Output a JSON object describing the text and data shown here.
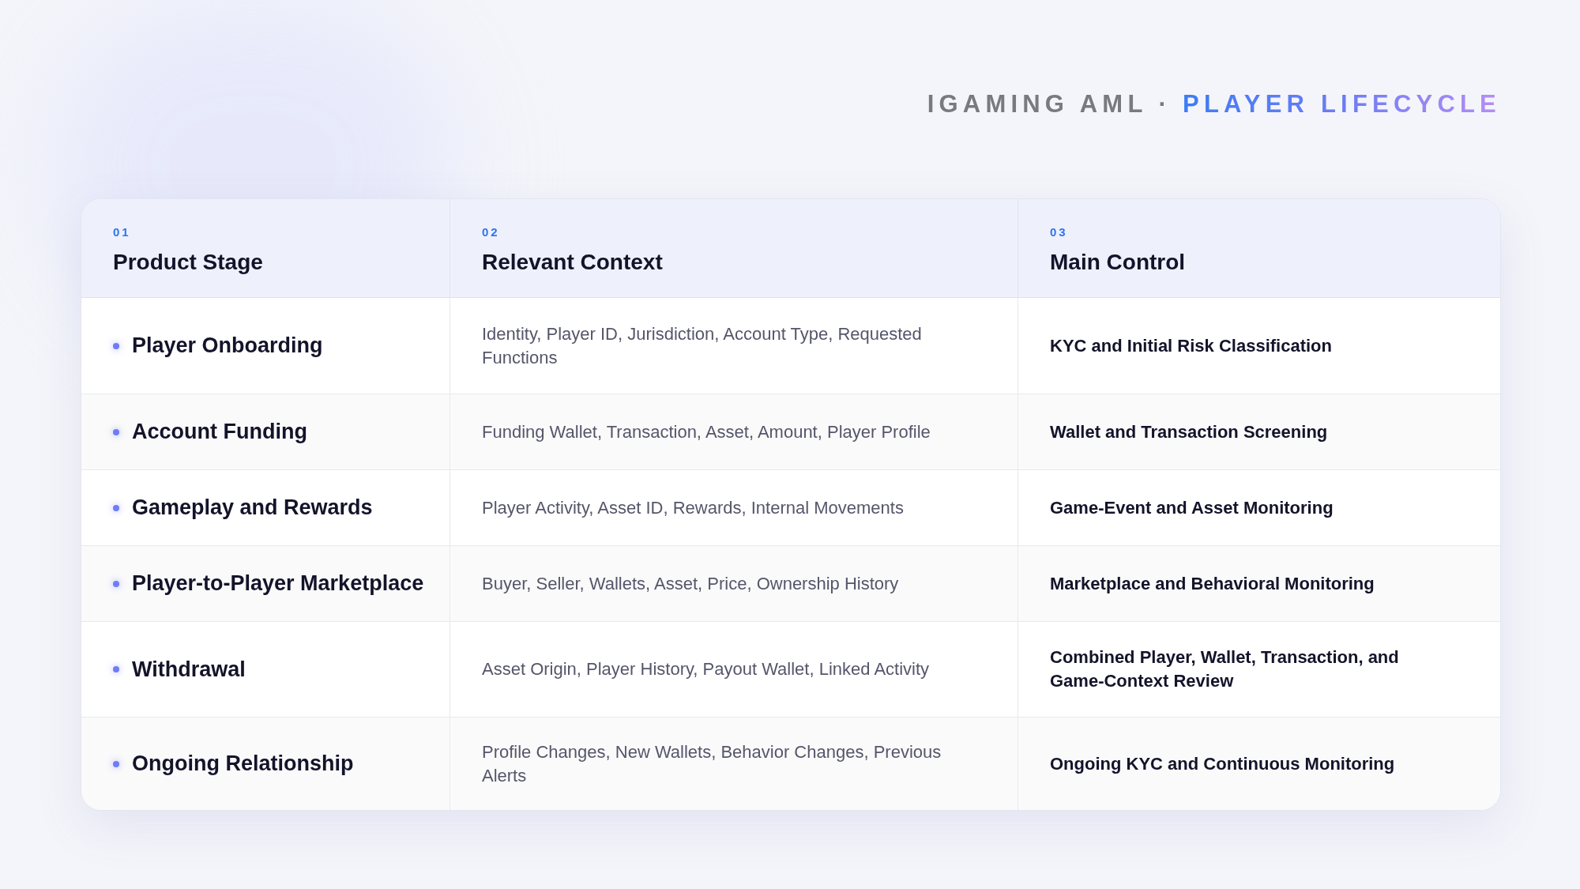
{
  "heading": {
    "prefix": "IGAMING AML",
    "separator": "·",
    "highlight": "PLAYER LIFECYCLE"
  },
  "table": {
    "columns": [
      {
        "number": "01",
        "title": "Product Stage"
      },
      {
        "number": "02",
        "title": "Relevant Context"
      },
      {
        "number": "03",
        "title": "Main Control"
      }
    ],
    "rows": [
      {
        "stage": "Player Onboarding",
        "context": "Identity, Player ID, Jurisdiction, Account Type, Requested Functions",
        "control": "KYC and Initial Risk Classification"
      },
      {
        "stage": "Account Funding",
        "context": "Funding Wallet, Transaction, Asset, Amount, Player Profile",
        "control": "Wallet and Transaction Screening"
      },
      {
        "stage": "Gameplay and Rewards",
        "context": "Player Activity, Asset ID, Rewards, Internal Movements",
        "control": "Game-Event and Asset Monitoring"
      },
      {
        "stage": "Player-to-Player Marketplace",
        "context": "Buyer, Seller, Wallets, Asset, Price, Ownership History",
        "control": "Marketplace and Behavioral Monitoring"
      },
      {
        "stage": "Withdrawal",
        "context": "Asset Origin, Player History, Payout Wallet, Linked Activity",
        "control": "Combined Player, Wallet, Transaction, and Game-Context Review"
      },
      {
        "stage": "Ongoing Relationship",
        "context": "Profile Changes, New Wallets, Behavior Changes, Previous Alerts",
        "control": "Ongoing KYC and Continuous Monitoring"
      }
    ]
  }
}
